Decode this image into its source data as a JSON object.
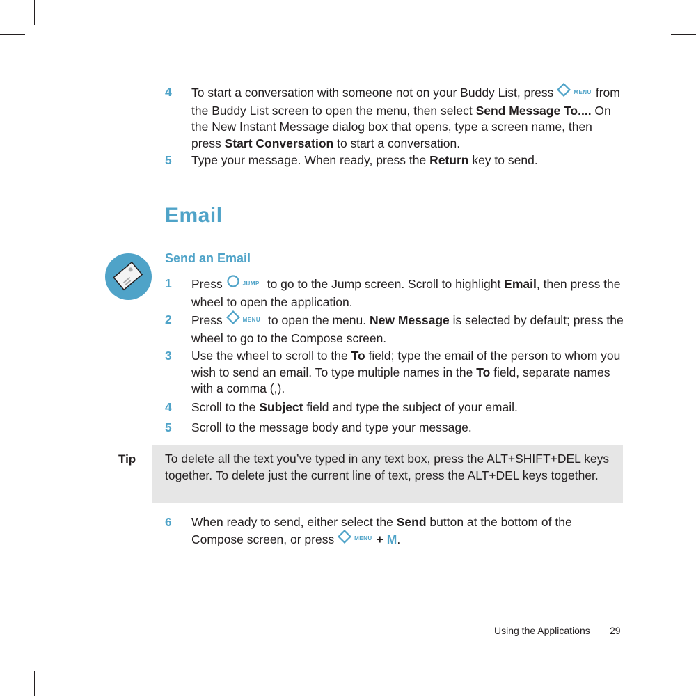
{
  "colors": {
    "accent": "#4fa3c8",
    "tip_background": "#e6e6e6",
    "text": "#231f20"
  },
  "top_steps": [
    {
      "num": "4",
      "segments": [
        {
          "t": "To start a conversation with someone not on your Buddy List, press "
        },
        {
          "icon": "menu"
        },
        {
          "t": "from the Buddy List screen to open the menu, then select "
        },
        {
          "b": "Send Message To...."
        },
        {
          "t": " On the New Instant Message dialog box that opens, type a screen name, then press "
        },
        {
          "b": "Start Conversation"
        },
        {
          "t": " to start a conversation."
        }
      ]
    },
    {
      "num": "5",
      "segments": [
        {
          "t": "Type your message. When ready, press the "
        },
        {
          "b": "Return"
        },
        {
          "t": " key to send."
        }
      ]
    }
  ],
  "section_title": "Email",
  "subsection_title": "Send an Email",
  "icons": {
    "menu_label": "MENU",
    "jump_label": "JUMP",
    "section_icon": "envelope-icon"
  },
  "email_steps": [
    {
      "num": "1",
      "segments": [
        {
          "t": "Press "
        },
        {
          "icon": "jump"
        },
        {
          "t": " to go to the Jump screen. Scroll to highlight "
        },
        {
          "b": "Email"
        },
        {
          "t": ", then press the wheel to open the application."
        }
      ]
    },
    {
      "num": "2",
      "segments": [
        {
          "t": "Press "
        },
        {
          "icon": "menu"
        },
        {
          "t": " to open the menu. "
        },
        {
          "b": "New Message"
        },
        {
          "t": " is selected by default; press the wheel to go to the Compose screen."
        }
      ]
    },
    {
      "num": "3",
      "segments": [
        {
          "t": "Use the wheel to scroll to the "
        },
        {
          "b": "To"
        },
        {
          "t": " field; type the email of the person to whom you wish to send an email. To type multiple names in the "
        },
        {
          "b": "To"
        },
        {
          "t": " field, separate names with a comma (,)."
        }
      ]
    },
    {
      "num": "4",
      "segments": [
        {
          "t": "Scroll to the "
        },
        {
          "b": "Subject"
        },
        {
          "t": " field and type the subject of your email."
        }
      ]
    },
    {
      "num": "5",
      "segments": [
        {
          "t": "Scroll to the message body and type your message."
        }
      ]
    }
  ],
  "tip": {
    "label": "Tip",
    "text": "To delete all the text you’ve typed in any text box, press the ALT+SHIFT+DEL keys together. To delete just the current line of text, press the ALT+DEL keys together."
  },
  "final_steps": [
    {
      "num": "6",
      "segments": [
        {
          "t": "When ready to send, either select the "
        },
        {
          "b": "Send"
        },
        {
          "t": " button at the bottom of the Compose screen, or press "
        },
        {
          "icon": "menu"
        },
        {
          "b": "+ "
        },
        {
          "key": "M"
        },
        {
          "t": "."
        }
      ]
    }
  ],
  "footer": {
    "section": "Using the Applications",
    "page": "29"
  }
}
